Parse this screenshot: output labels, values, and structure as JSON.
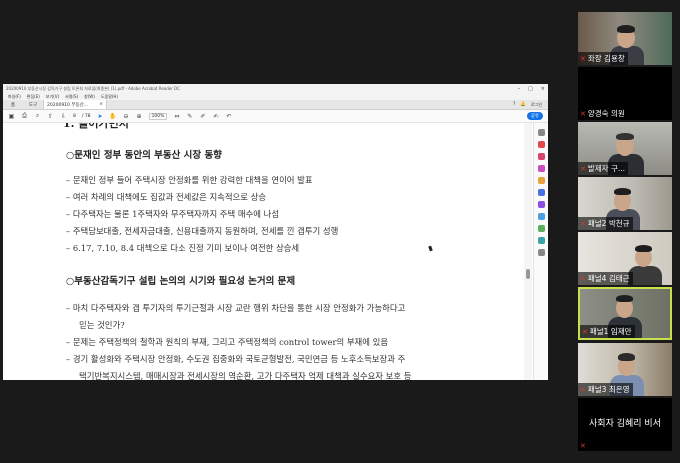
{
  "acrobat": {
    "title": "20200910 부동산시장 감독기구 설립 토론회 자료집(최종본) (1).pdf - Adobe Acrobat Reader DC",
    "menu": [
      "파일(F)",
      "편집(E)",
      "보기(V)",
      "서명(S)",
      "창(W)",
      "도움말(H)"
    ],
    "tabs": {
      "home": "홈",
      "tools": "도구",
      "doc": "20200910 부동산..."
    },
    "user": "로그인",
    "page_current": "8",
    "page_total": "/ 78",
    "zoom": "100%",
    "share_label": "공유"
  },
  "document": {
    "heading": "1. 들어가면서",
    "section1": "○문재인 정부 동안의 부동산 시장 동향",
    "section1_items": [
      "– 문재인 정부 들어 주택시장 안정화를 위한 강력한 대책을 연이어 발표",
      "– 여러 차례의 대책에도 집값과 전세값은 지속적으로 상승",
      "– 다주택자는 물론 1주택자와 무주택자까지 주택 매수에 나섬",
      "– 주택담보대출, 전세자금대출, 신용대출까지 동원하며, 전세를 낀 갭투기 성행",
      "– 6.17, 7.10, 8.4 대책으로 다소 진정 기미 보이나 여전한 상승세"
    ],
    "section2": "○부동산감독기구 설립 논의의 시기와 필요성 논거의 문제",
    "section2_items": [
      "– 마치 다주택자와 갭 투기자의 투기근절과 시장 교란 행위 차단을 통한 시장 안정화가 가능하다고",
      "믿는 것인가?",
      "– 문제는 주택정책의 철학과 원칙의 부재, 그리고 주택정책의 control tower의 부재에 있음",
      "– 경기 활성화와 주택시장 안정화, 수도권 집중화와 국토균형발전, 국민연금 등 노후소득보장과 주",
      "택기반복지시스템, 매매시장과 전세시장의 역순환, 고가 다주택자 억제 대책과 실수요자 보호 등"
    ]
  },
  "participants": [
    {
      "name": "좌장 김용창",
      "muted": true,
      "video": true
    },
    {
      "name": "양경숙 의원",
      "muted": true,
      "video": false
    },
    {
      "name": "발제자 구...",
      "muted": true,
      "video": true
    },
    {
      "name": "패널2 박천규",
      "muted": true,
      "video": true
    },
    {
      "name": "패널4 김태근",
      "muted": true,
      "video": true
    },
    {
      "name": "패널1 임재만",
      "muted": true,
      "video": true,
      "active": true
    },
    {
      "name": "패널3 최은영",
      "muted": true,
      "video": true
    },
    {
      "name": "사회자 김혜리 비서",
      "muted": true,
      "video": false
    }
  ],
  "colors": {
    "active_border": "#c8e04a",
    "muted_mic": "#e03232",
    "share_button": "#1473e6"
  }
}
